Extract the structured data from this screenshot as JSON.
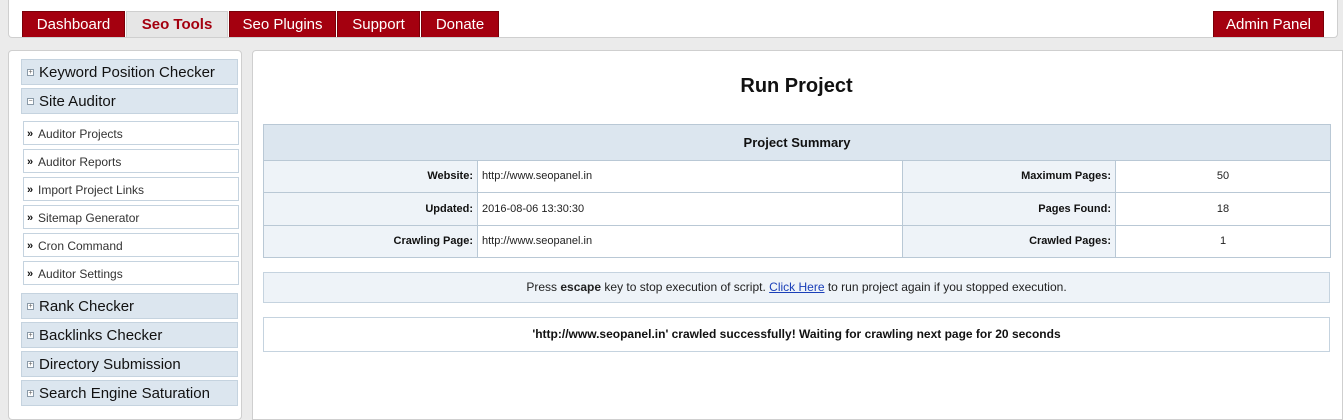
{
  "nav": {
    "tabs": [
      {
        "label": "Dashboard"
      },
      {
        "label": "Seo Tools"
      },
      {
        "label": "Seo Plugins"
      },
      {
        "label": "Support"
      },
      {
        "label": "Donate"
      }
    ],
    "admin_label": "Admin Panel"
  },
  "sidebar": {
    "top_items": [
      {
        "label": "Keyword Position Checker",
        "expanded": false
      },
      {
        "label": "Site Auditor",
        "expanded": true
      }
    ],
    "sub_items": [
      {
        "label": "Auditor Projects"
      },
      {
        "label": "Auditor Reports"
      },
      {
        "label": "Import Project Links"
      },
      {
        "label": "Sitemap Generator"
      },
      {
        "label": "Cron Command"
      },
      {
        "label": "Auditor Settings"
      }
    ],
    "bottom_items": [
      {
        "label": "Rank Checker",
        "expanded": false
      },
      {
        "label": "Backlinks Checker",
        "expanded": false
      },
      {
        "label": "Directory Submission",
        "expanded": false
      },
      {
        "label": "Search Engine Saturation",
        "expanded": false
      }
    ],
    "expand_glyph": "+",
    "collapse_glyph": "−",
    "sub_glyph": "»"
  },
  "main": {
    "title": "Run Project",
    "summary": {
      "heading": "Project Summary",
      "website_label": "Website:",
      "website_value": "http://www.seopanel.in",
      "max_pages_label": "Maximum Pages:",
      "max_pages_value": "50",
      "updated_label": "Updated:",
      "updated_value": "2016-08-06 13:30:30",
      "pages_found_label": "Pages Found:",
      "pages_found_value": "18",
      "crawling_label": "Crawling Page:",
      "crawling_value": "http://www.seopanel.in",
      "crawled_label": "Crawled Pages:",
      "crawled_value": "1"
    },
    "notice": {
      "prefix": "Press ",
      "key": "escape",
      "middle": " key to stop execution of script. ",
      "link": "Click Here",
      "suffix": " to run project again if you stopped execution."
    },
    "status": "'http://www.seopanel.in' crawled successfully! Waiting for crawling next page for 20 seconds"
  },
  "colors": {
    "nav_red": "#a4000f",
    "menu_blue": "#dce6ef",
    "link_blue": "#1a3fb8"
  }
}
